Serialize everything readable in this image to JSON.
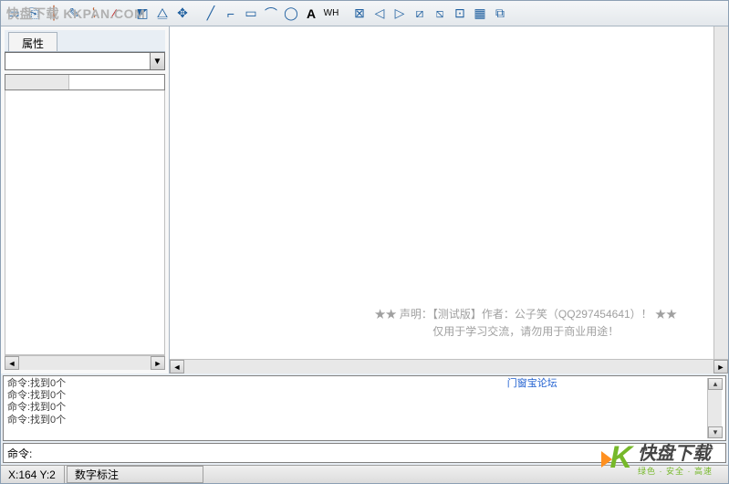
{
  "watermark_top": "快盘下载 KKPAN.COM",
  "toolbar": {
    "icons": [
      "box",
      "copy",
      "cut",
      "edit",
      "pencil",
      "brush",
      "redline",
      "hatch",
      "triangle",
      "move",
      "line1",
      "line2",
      "rect",
      "arc",
      "circle",
      "A",
      "WH",
      "flip1",
      "flip2",
      "flip3",
      "flip4",
      "flip5",
      "flip6",
      "grid",
      "flip7"
    ]
  },
  "sidebar": {
    "tab": "属性"
  },
  "canvas": {
    "line1": "★★  声明：【测试版】作者：公子笑（QQ297454641）！  ★★",
    "line2": "仅用于学习交流，请勿用于商业用途！"
  },
  "console": {
    "lines": [
      "命令:找到0个",
      "命令:找到0个",
      "命令:找到0个",
      "命令:找到0个"
    ],
    "link": "门窗宝论坛"
  },
  "cmdline": {
    "label": "命令:"
  },
  "status": {
    "coords": "X:164  Y:2",
    "mode": "数字标注"
  },
  "watermark_logo": {
    "main": "快盘下载",
    "sub": "绿色 · 安全 · 高速"
  }
}
